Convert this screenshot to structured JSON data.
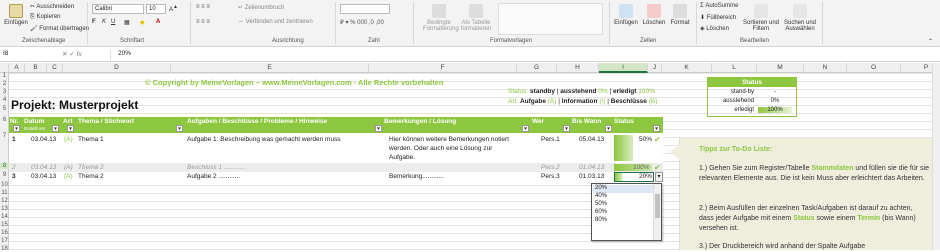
{
  "ribbon": {
    "paste": "Einfügen",
    "cut": "Ausschneiden",
    "copy": "Kopieren",
    "format_painter": "Format übertragen",
    "font_name": "Calibri",
    "font_size": "10",
    "wrap": "Zeilenumbruch",
    "merge": "Verbinden und zentrieren",
    "cond_format": "Bedingte Formatierung",
    "as_table": "Als Tabelle formatieren",
    "insert": "Einfügen",
    "delete": "Löschen",
    "format": "Format",
    "autosum": "AutoSumme",
    "fill": "Füllbereich",
    "clear": "Löschen",
    "sort": "Sortieren und Filtern",
    "find": "Suchen und Auswählen",
    "groups": {
      "clipboard": "Zwischenablage",
      "font": "Schriftart",
      "alignment": "Ausrichtung",
      "number": "Zahl",
      "styles": "Formatvorlagen",
      "cells": "Zellen",
      "editing": "Bearbeiten"
    }
  },
  "formula_bar": {
    "name_box": "I8",
    "fx": "fx",
    "value": "20%"
  },
  "columns": [
    "A",
    "B",
    "C",
    "D",
    "E",
    "F",
    "G",
    "H",
    "I",
    "J",
    "K",
    "L",
    "M",
    "N",
    "O",
    "P"
  ],
  "rows": [
    "1",
    "2",
    "3",
    "4",
    "5",
    "6",
    "7",
    "8",
    "9",
    "10",
    "11",
    "12",
    "13",
    "14",
    "15",
    "16",
    "17",
    "18",
    "19",
    "20",
    "21",
    "22"
  ],
  "sheet": {
    "copyright": "© Copyright by MeineVorlagen – www.MeineVorlagen.com - Alle Rechte vorbehalten",
    "project_title": "Projekt:  Musterprojekt",
    "status_line1": {
      "status": "Status:",
      "standby": "standby",
      "sep1": "|",
      "pending": "ausstehend",
      "pending_pct": "0%",
      "sep2": "|",
      "done": "erledigt",
      "done_pct": "100%"
    },
    "status_line2": {
      "art": "Art:",
      "task": "Aufgabe",
      "task_code": "(A)",
      "sep1": "|",
      "info": "Information",
      "info_code": "(I)",
      "sep2": "|",
      "decision": "Beschlüsse",
      "decision_code": "(B)"
    },
    "status_panel": {
      "title": "Status",
      "rows": [
        {
          "label": "stand-by",
          "value": "-"
        },
        {
          "label": "ausstehend",
          "value": "0%"
        },
        {
          "label": "erledigt",
          "value": "100%"
        }
      ]
    },
    "headers": {
      "nr": "Nr.",
      "date": "Datum",
      "date_sub": "Erstellt am",
      "art": "Art",
      "topic": "Thema / Stichwort",
      "tasks": "Aufgaben / Beschlüsse / Probleme / Hinweise",
      "notes": "Bemerkungen / Lösung",
      "who": "Wer",
      "when": "Bis Wann",
      "status": "Status"
    },
    "table_rows": [
      {
        "nr": "1",
        "date": "03.04.13",
        "art": "(A)",
        "topic": "Thema 1",
        "task": "Aufgabe 1:  Beschreibung  was gemacht werden muss",
        "notes": [
          "Hier können weitere Bemerkungen notiert",
          "werden. Oder auch eine Lösung zur",
          "Aufgabe."
        ],
        "who": "Pers.1",
        "when": "05.04.13",
        "status": "50%"
      },
      {
        "nr": "2",
        "date": "03.04.13",
        "art": "(A)",
        "topic": "Thema 2",
        "task": "Beschluss 1 ............",
        "notes": [
          ""
        ],
        "who": "Pers.2",
        "when": "01.04.13",
        "status": "100%"
      },
      {
        "nr": "3",
        "date": "03.04.13",
        "art": "(A)",
        "topic": "Thema 2",
        "task": "Aufgabe 2 ............",
        "notes": [
          "Bemerkung............"
        ],
        "who": "Pers.3",
        "when": "01.03.13",
        "status": "20%"
      }
    ],
    "dropdown_options": [
      "20%",
      "40%",
      "50%",
      "60%",
      "80%"
    ],
    "tips": {
      "title": "Tipps zur To-Do Liste:",
      "p1": [
        "1.) Gehen Sie zum Register/Tabelle ",
        "Stammdaten",
        " und füllen sie die für sie relevanten Elemente aus. Die ist kein Muss aber erleichtert das Arbeiten."
      ],
      "p2": [
        "2.) Beim Ausfüllen der einzelnen Task/Aufgaben ist darauf zu achten, dass jeder Aufgabe mit einem ",
        "Status",
        " sowie einem ",
        "Termin",
        " (bis Wann) versehen ist."
      ],
      "p3": "3.) Der Druckbereich wird anhand der Spalte Aufgabe"
    }
  },
  "colors": {
    "accent": "#8dc63f",
    "excel_green": "#217346",
    "tips_bg": "#efeedd"
  }
}
